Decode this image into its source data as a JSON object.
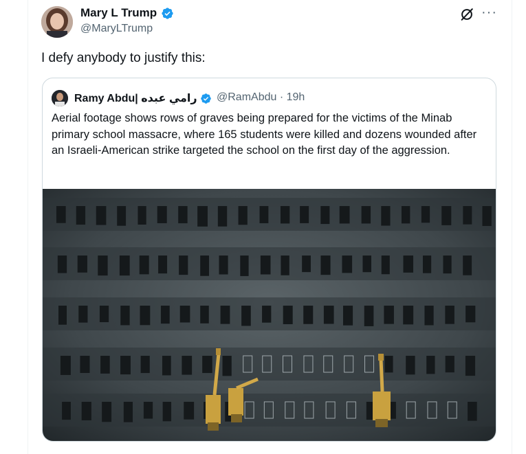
{
  "tweet": {
    "author_name": "Mary L Trump",
    "author_handle": "@MaryLTrump",
    "text": "I defy anybody to justify this:"
  },
  "quote": {
    "author_name": "Ramy Abdu| رامي عبده",
    "author_handle_time": "@RamAbdu · 19h",
    "text": "Aerial footage shows rows of graves being prepared for the victims of the Minab primary school massacre, where 165 students were killed and dozens wounded after an Israeli-American strike targeted the school on the first day of the aggression."
  },
  "icons": {
    "verified": "verified-badge-icon",
    "grok": "grok-icon",
    "more": "more-icon"
  },
  "colors": {
    "verified": "#1d9bf0",
    "text": "#0f1419",
    "secondary": "#536471",
    "border": "#cfd9de"
  }
}
